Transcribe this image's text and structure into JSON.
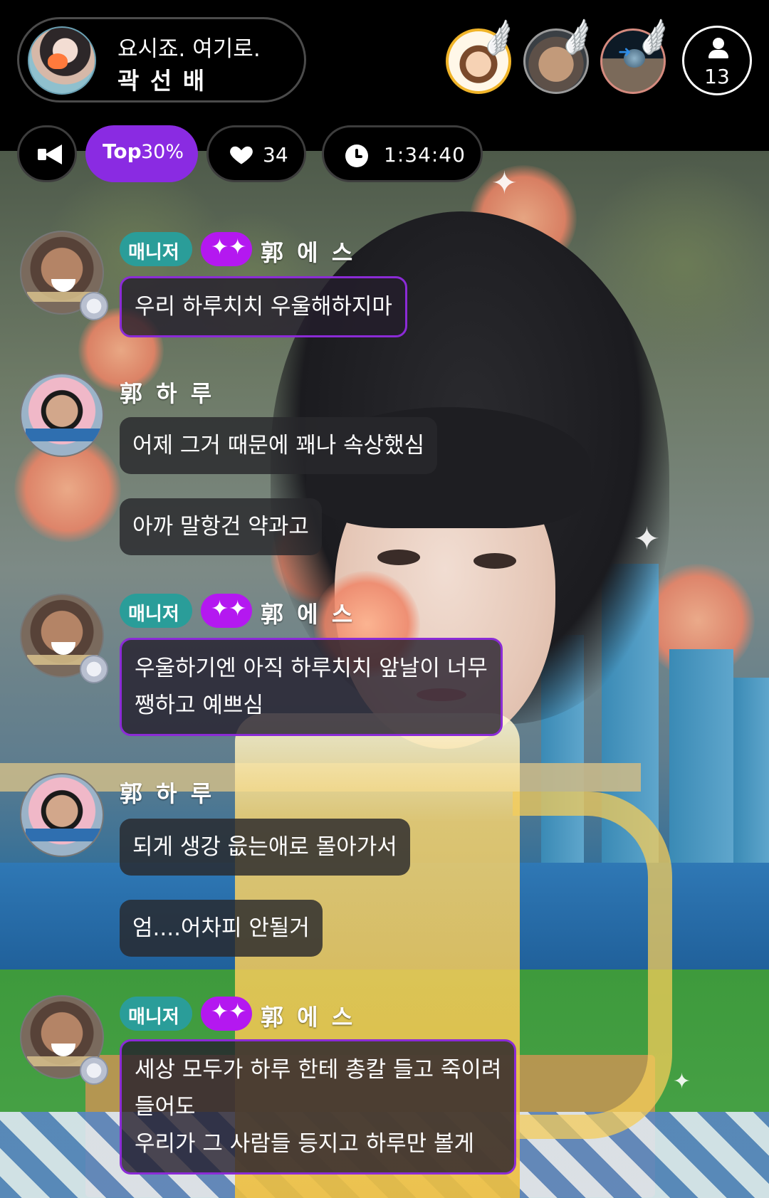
{
  "header": {
    "host_subtitle": "요시죠. 여기로.",
    "host_name": "곽 선 배",
    "viewer_count": "13",
    "icons": [
      "host-avatar",
      "viewer-avatar",
      "wing-badge-icon",
      "person-icon"
    ]
  },
  "stats": {
    "rank_prefix": "Top",
    "rank_value": "30%",
    "likes": "34",
    "elapsed": "1:34:40",
    "accent_color": "#8a2be2"
  },
  "chat": {
    "manager_label": "매니저",
    "fan_badge": "✦✦",
    "messages": [
      {
        "nick": "郭 에 스",
        "text": "우리 하루치치 우울해하지마"
      },
      {
        "nick": "郭 하 루",
        "text": "어제 그거 때문에 꽤나 속상했심"
      },
      {
        "text": "아까 말항건 약과고"
      },
      {
        "nick": "郭 에 스",
        "text": "우울하기엔 아직 하루치치 앞날이 너무\n쨍하고 예쁘심"
      },
      {
        "nick": "郭 하 루",
        "text": "되게 생강 읎는애로 몰아가서"
      },
      {
        "text": "엄....어차피 안될거"
      },
      {
        "nick": "郭 에 스",
        "text": "세상 모두가 하루 한테 총칼 들고 죽이려\n들어도\n우리가 그 사람들 등지고 하루만 볼게"
      }
    ]
  }
}
